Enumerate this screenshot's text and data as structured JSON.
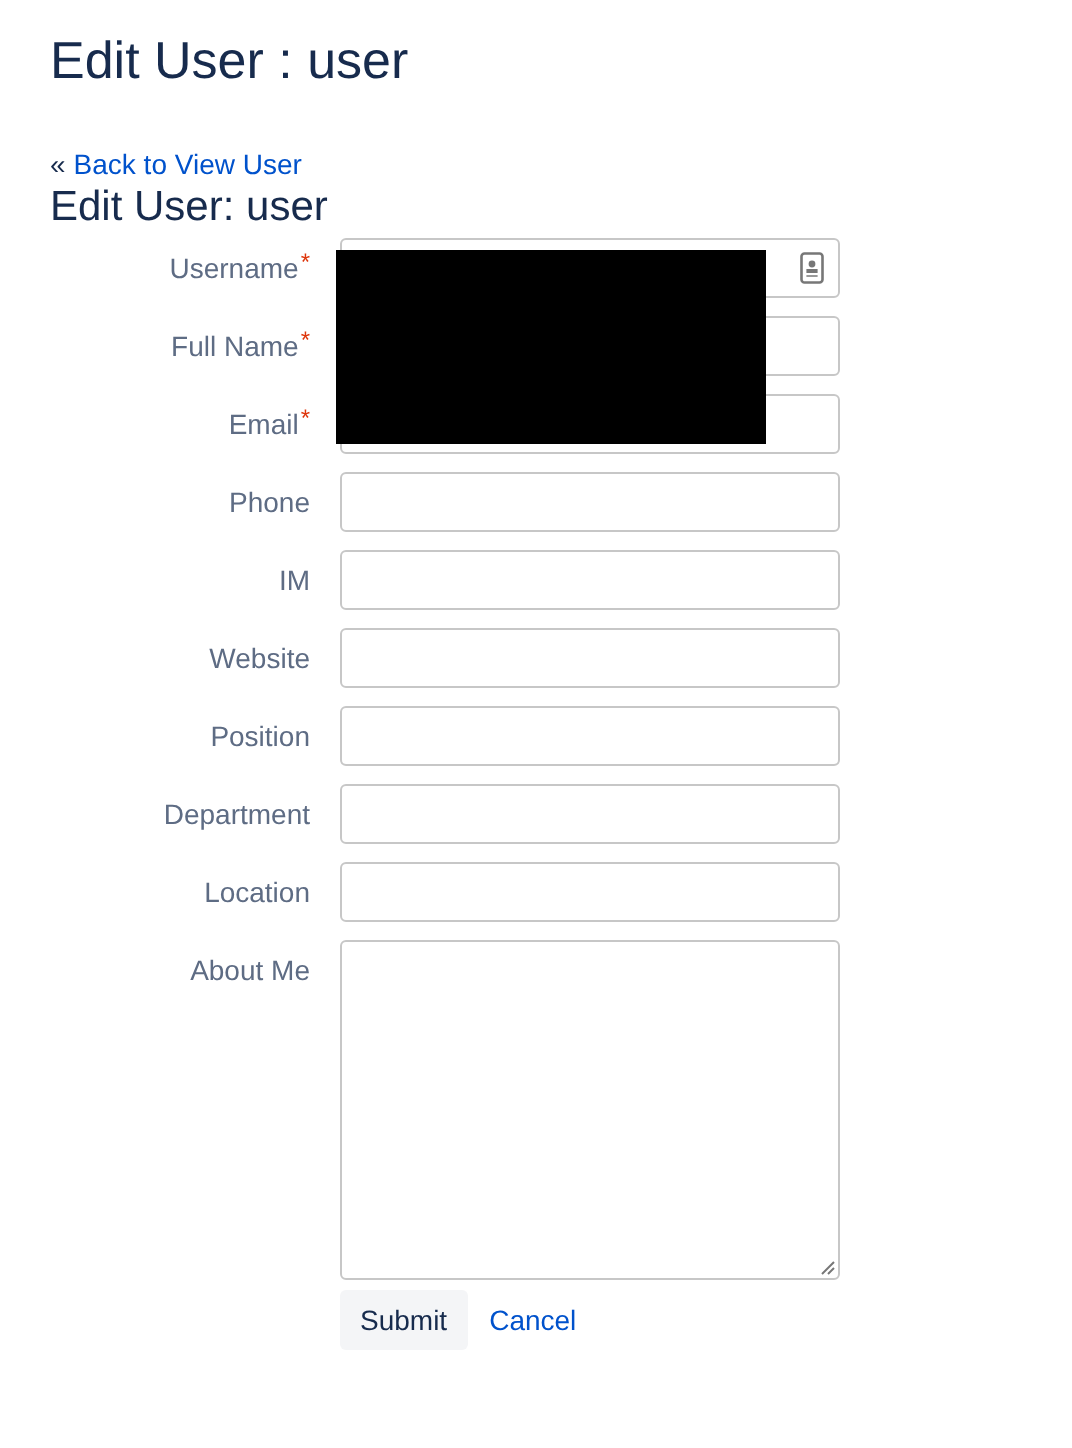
{
  "page_title": "Edit User : user",
  "back_link": {
    "prefix": "«",
    "label": "Back to View User"
  },
  "form_title": "Edit User: user",
  "required_mark": "*",
  "fields": [
    {
      "label": "Username",
      "required": true,
      "kind": "text",
      "has_card_icon": true
    },
    {
      "label": "Full Name",
      "required": true,
      "kind": "text"
    },
    {
      "label": "Email",
      "required": true,
      "kind": "text"
    },
    {
      "label": "Phone",
      "required": false,
      "kind": "text"
    },
    {
      "label": "IM",
      "required": false,
      "kind": "text"
    },
    {
      "label": "Website",
      "required": false,
      "kind": "text"
    },
    {
      "label": "Position",
      "required": false,
      "kind": "text"
    },
    {
      "label": "Department",
      "required": false,
      "kind": "text"
    },
    {
      "label": "Location",
      "required": false,
      "kind": "text"
    },
    {
      "label": "About Me",
      "required": false,
      "kind": "textarea"
    }
  ],
  "redaction": {
    "shown": true
  },
  "buttons": [
    {
      "label": "Submit",
      "kind": "button"
    },
    {
      "label": "Cancel",
      "kind": "link"
    }
  ]
}
